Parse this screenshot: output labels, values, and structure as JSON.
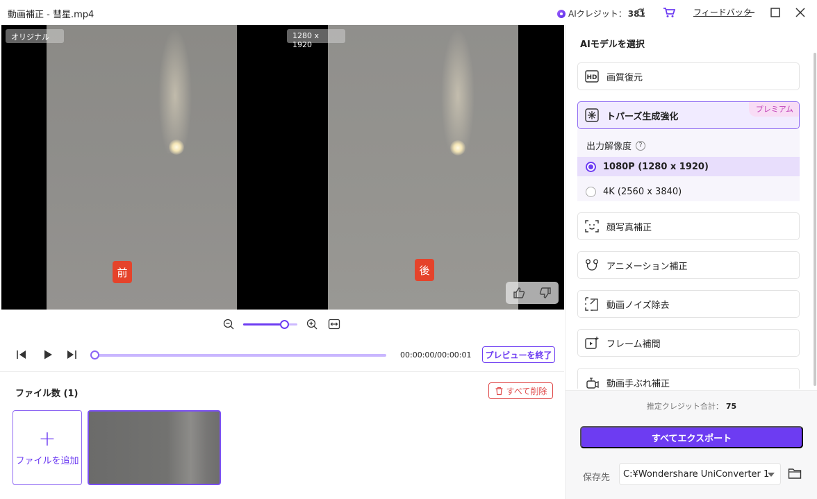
{
  "window": {
    "title": "動画補正 - 彗星.mp4",
    "credit_label": "AIクレジット：",
    "credit_value": "381",
    "feedback": "フィードバック"
  },
  "preview": {
    "left_tag": "オリジナル",
    "right_tag": "1280 x 1920",
    "before_badge": "前",
    "after_badge": "後",
    "zoom_level": 0.77
  },
  "playback": {
    "time": "00:00:00/00:00:01",
    "progress": 0,
    "exit_preview": "プレビューを終了"
  },
  "files": {
    "title": "ファイル数 (1)",
    "delete_all": "すべて削除",
    "add_file": "ファイルを追加",
    "add_plus": "+"
  },
  "panel": {
    "title": "AIモデルを選択",
    "models": [
      {
        "label": "画質復元",
        "icon": "hd-icon"
      },
      {
        "label": "トパーズ生成強化",
        "icon": "sparkle-icon",
        "badge": "プレミアム"
      },
      {
        "label": "顔写真補正",
        "icon": "face-scan-icon"
      },
      {
        "label": "アニメーション補正",
        "icon": "bear-icon"
      },
      {
        "label": "動画ノイズ除去",
        "icon": "noise-icon"
      },
      {
        "label": "フレーム補間",
        "icon": "frame-icon"
      },
      {
        "label": "動画手ぶれ補正",
        "icon": "stabilize-icon"
      }
    ],
    "resolution_label": "出力解像度",
    "help": "?",
    "options": [
      {
        "label": "1080P (1280 x 1920)",
        "selected": true
      },
      {
        "label": "4K (2560 x 3840)",
        "selected": false
      }
    ],
    "estimate_label": "推定クレジット合計：",
    "estimate_value": "75",
    "export_all": "すべてエクスポート",
    "save_label": "保存先",
    "save_path": "C:¥Wondershare UniConverter 1"
  },
  "colors": {
    "accent": "#6d3cf2",
    "danger": "#e04b4b",
    "badge": "#e5432b"
  }
}
